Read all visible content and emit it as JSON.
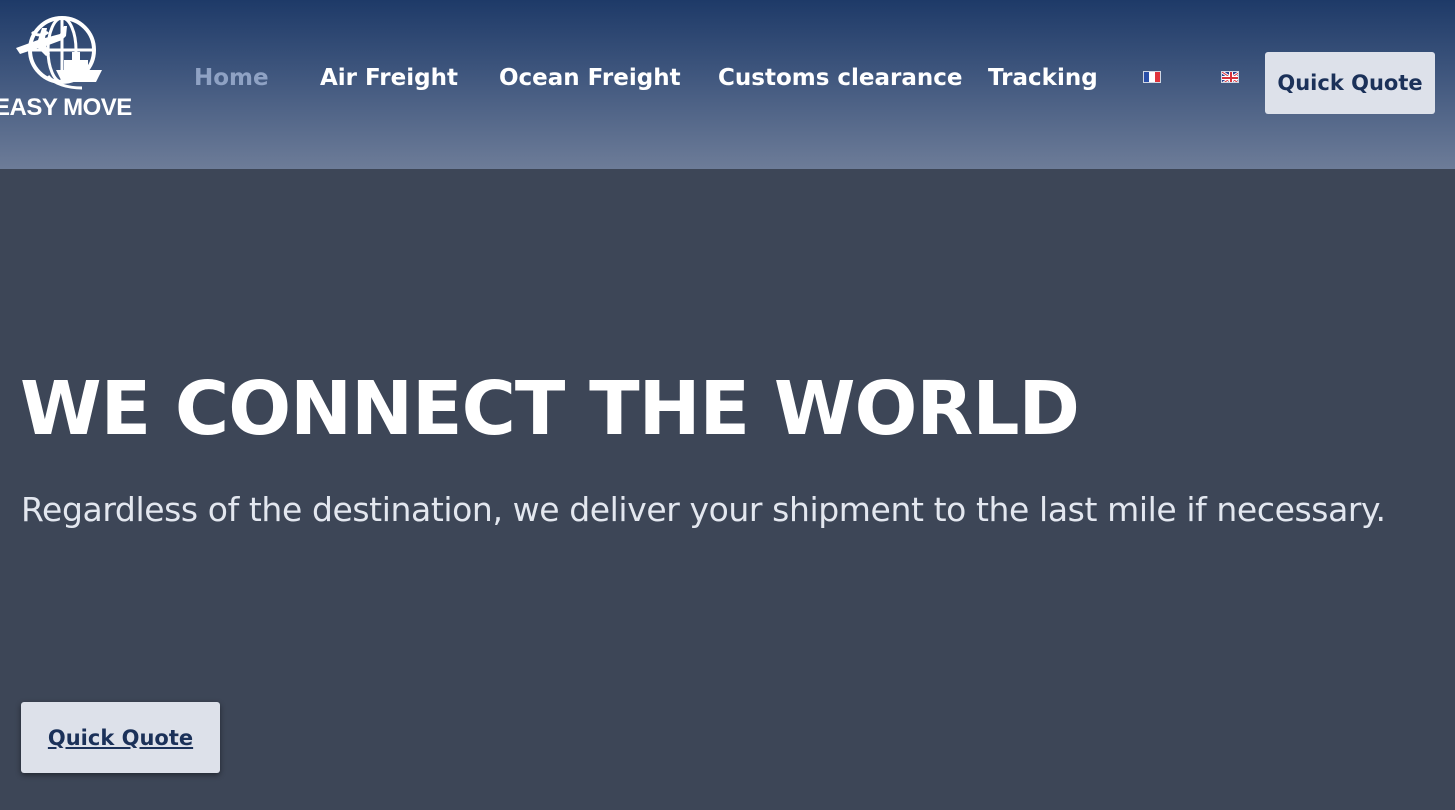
{
  "brand": {
    "name": "EASY MOVE"
  },
  "nav": {
    "items": [
      {
        "label": "Home",
        "active": true
      },
      {
        "label": "Air Freight",
        "active": false
      },
      {
        "label": "Ocean Freight",
        "active": false
      },
      {
        "label": "Customs clearance",
        "active": false
      },
      {
        "label": "Tracking",
        "active": false
      }
    ],
    "languages": [
      "fr-flag-icon",
      "uk-flag-icon"
    ],
    "cta_label": "Quick Quote"
  },
  "hero": {
    "title": "WE CONNECT THE WORLD",
    "subtitle": "Regardless of the destination, we deliver your shipment to the last mile if necessary.",
    "cta_label": "Quick Quote"
  },
  "colors": {
    "header_top": "#1e3a68",
    "header_bottom": "#6d7c98",
    "hero_bg": "#3d4657",
    "button_bg": "#dde1ea",
    "button_text": "#1b3159",
    "active_nav": "#8fa2c4"
  }
}
